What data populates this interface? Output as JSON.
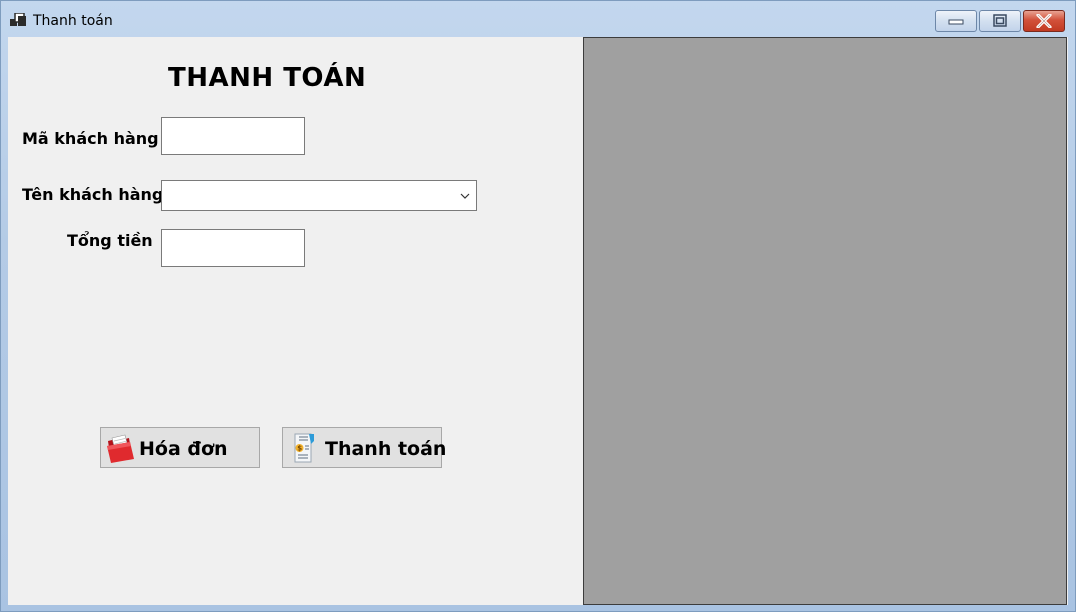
{
  "window": {
    "title": "Thanh toán",
    "controls": {
      "minimize": "minimize-icon",
      "maximize": "restore-icon",
      "close": "close-icon"
    }
  },
  "form": {
    "heading": "THANH TOÁN",
    "fields": {
      "customer_id": {
        "label": "Mã khách hàng",
        "value": ""
      },
      "customer_name": {
        "label": "Tên khách hàng",
        "value": ""
      },
      "total": {
        "label": "Tổng tiền",
        "value": ""
      }
    },
    "buttons": {
      "invoice": {
        "label": "Hóa đơn",
        "icon": "folder-icon"
      },
      "pay": {
        "label": "Thanh toán",
        "icon": "receipt-icon"
      }
    }
  },
  "colors": {
    "client_bg": "#f0f0f0",
    "panel_bg": "#a0a0a0",
    "close_button": "#c13a22"
  }
}
